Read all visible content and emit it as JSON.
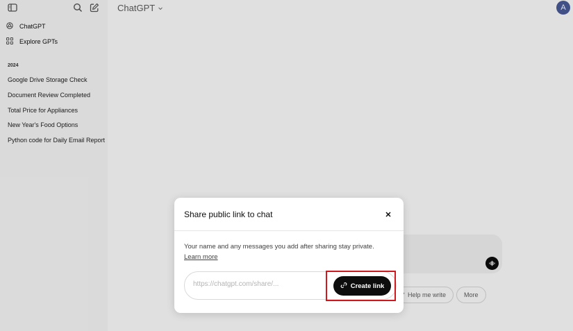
{
  "sidebar": {
    "nav": [
      {
        "label": "ChatGPT",
        "icon": "openai-logo-icon"
      },
      {
        "label": "Explore GPTs",
        "icon": "grid-icon"
      }
    ],
    "section_label": "2024",
    "history": [
      "Google Drive Storage Check",
      "Document Review Completed",
      "Total Price for Appliances",
      "New Year's Food Options",
      "Python code for Daily Email Report"
    ]
  },
  "header": {
    "model_label": "ChatGPT",
    "avatar_initial": "A"
  },
  "suggestions": {
    "help_write": "Help me write",
    "more": "More"
  },
  "modal": {
    "title": "Share public link to chat",
    "body_text": "Your name and any messages you add after sharing stay private.",
    "learn_more": "Learn more",
    "link_placeholder": "https://chatgpt.com/share/...",
    "create_link_label": "Create link"
  },
  "colors": {
    "highlight": "#d0191f",
    "primary_button": "#0d0d0d",
    "avatar": "#4a5a9a"
  }
}
